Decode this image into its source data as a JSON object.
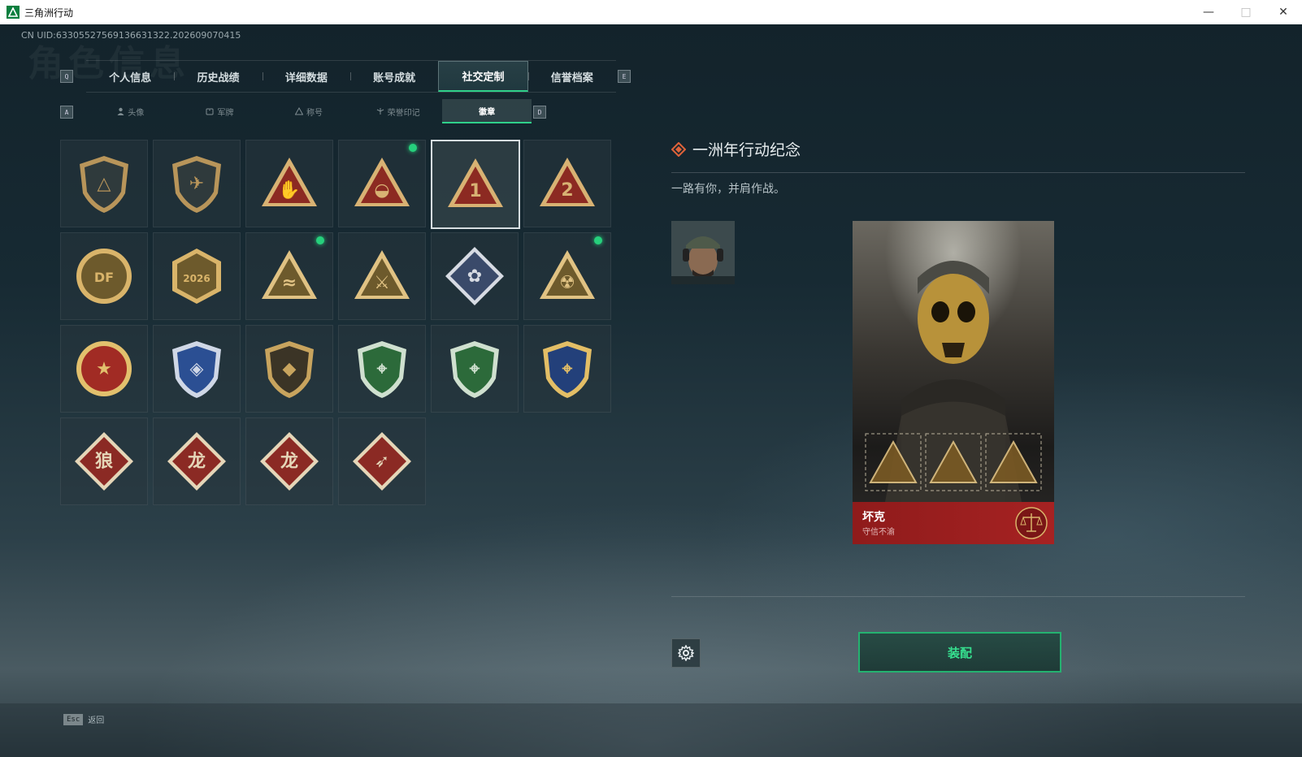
{
  "window": {
    "title": "三角洲行动",
    "controls": {
      "minimize": "—",
      "maximize": "□",
      "close": "✕"
    }
  },
  "uid_text": "CN UID:63305527569136631322.202609070415",
  "background_watermark": "角色信息",
  "key_hints": {
    "prev_tab": "Q",
    "next_tab": "E",
    "prev_subtab": "A",
    "next_subtab": "D"
  },
  "tabs": [
    {
      "label": "个人信息",
      "active": false
    },
    {
      "label": "历史战绩",
      "active": false
    },
    {
      "label": "详细数据",
      "active": false
    },
    {
      "label": "账号成就",
      "active": false
    },
    {
      "label": "社交定制",
      "active": true
    },
    {
      "label": "信誉档案",
      "active": false
    }
  ],
  "subtabs": [
    {
      "label": "头像",
      "icon": "person-icon",
      "active": false
    },
    {
      "label": "军牌",
      "icon": "dogtag-icon",
      "active": false
    },
    {
      "label": "称号",
      "icon": "title-icon",
      "active": false
    },
    {
      "label": "荣誉印记",
      "icon": "honor-icon",
      "active": false
    },
    {
      "label": "徽章",
      "icon": "",
      "active": true
    }
  ],
  "badges": [
    {
      "name": "badge-shield-delta",
      "new": false,
      "selected": false,
      "kind": "shield",
      "primary": "#2f3a3c",
      "accent": "#b8955a",
      "glyph": "△"
    },
    {
      "name": "badge-helicopter",
      "new": false,
      "selected": false,
      "kind": "shield",
      "primary": "#2f3a3c",
      "accent": "#b8955a",
      "glyph": "✈"
    },
    {
      "name": "badge-rock-hand",
      "new": false,
      "selected": false,
      "kind": "triangle",
      "primary": "#8c2a22",
      "accent": "#d8b273",
      "glyph": "✋"
    },
    {
      "name": "badge-nest",
      "new": true,
      "selected": false,
      "kind": "triangle",
      "primary": "#8c2a22",
      "accent": "#d8b273",
      "glyph": "◒"
    },
    {
      "name": "badge-number-one",
      "new": false,
      "selected": true,
      "kind": "triangle",
      "primary": "#8c2a22",
      "accent": "#d8b273",
      "glyph": "1"
    },
    {
      "name": "badge-number-two",
      "new": false,
      "selected": false,
      "kind": "triangle",
      "primary": "#8c2a22",
      "accent": "#d8b273",
      "glyph": "2"
    },
    {
      "name": "badge-delta-force-2025",
      "new": false,
      "selected": false,
      "kind": "round",
      "primary": "#6d5a2c",
      "accent": "#d9b46a",
      "glyph": "DF"
    },
    {
      "name": "badge-delta-force-2026",
      "new": false,
      "selected": false,
      "kind": "hex",
      "primary": "#6d5a2c",
      "accent": "#d9b46a",
      "glyph": "2026"
    },
    {
      "name": "badge-wave-rider",
      "new": true,
      "selected": false,
      "kind": "triangle",
      "primary": "#6d5a2c",
      "accent": "#e0c283",
      "glyph": "≈"
    },
    {
      "name": "badge-soldiers",
      "new": false,
      "selected": false,
      "kind": "triangle",
      "primary": "#6d5a2c",
      "accent": "#e0c283",
      "glyph": "⚔"
    },
    {
      "name": "badge-white-rose",
      "new": false,
      "selected": false,
      "kind": "diamond",
      "primary": "#3a4a6a",
      "accent": "#d7dbe3",
      "glyph": "✿"
    },
    {
      "name": "badge-hazmat",
      "new": true,
      "selected": false,
      "kind": "triangle",
      "primary": "#6d5a2c",
      "accent": "#e0c283",
      "glyph": "☢"
    },
    {
      "name": "badge-star-medal",
      "new": false,
      "selected": false,
      "kind": "round",
      "primary": "#a12b24",
      "accent": "#e2c06d",
      "glyph": "★"
    },
    {
      "name": "badge-blue-wings",
      "new": false,
      "selected": false,
      "kind": "shield",
      "primary": "#2b4f93",
      "accent": "#cfd7e6",
      "glyph": "◈"
    },
    {
      "name": "badge-gem-shield",
      "new": false,
      "selected": false,
      "kind": "shield",
      "primary": "#3b3426",
      "accent": "#c8a45e",
      "glyph": "◆"
    },
    {
      "name": "badge-green-rifle-1",
      "new": false,
      "selected": false,
      "kind": "shield",
      "primary": "#2c6a3a",
      "accent": "#cfe0cf",
      "glyph": "⌖"
    },
    {
      "name": "badge-green-rifle-2",
      "new": false,
      "selected": false,
      "kind": "shield",
      "primary": "#2c6a3a",
      "accent": "#cfe0cf",
      "glyph": "⌖"
    },
    {
      "name": "badge-navy-rifle",
      "new": false,
      "selected": false,
      "kind": "shield",
      "primary": "#23407a",
      "accent": "#e3be66",
      "glyph": "⌖"
    },
    {
      "name": "badge-wolf",
      "new": false,
      "selected": false,
      "kind": "diamond",
      "primary": "#8b2a24",
      "accent": "#e5d6b8",
      "glyph": "狼"
    },
    {
      "name": "badge-dragon-1",
      "new": false,
      "selected": false,
      "kind": "diamond",
      "primary": "#8b2a24",
      "accent": "#e5d6b8",
      "glyph": "龙"
    },
    {
      "name": "badge-dragon-2",
      "new": false,
      "selected": false,
      "kind": "diamond",
      "primary": "#8b2a24",
      "accent": "#e5d6b8",
      "glyph": "龙"
    },
    {
      "name": "badge-runner",
      "new": false,
      "selected": false,
      "kind": "diamond",
      "primary": "#8b2a24",
      "accent": "#e5d6b8",
      "glyph": "➶"
    }
  ],
  "detail": {
    "title": "一洲年行动纪念",
    "description": "一路有你，并肩作战。",
    "preview": {
      "name": "坏克",
      "subtitle": "守信不渝"
    }
  },
  "actions": {
    "equip_label": "装配"
  },
  "footer": {
    "esc_key": "Esc",
    "back_label": "返回"
  },
  "colors": {
    "accent_green": "#2fd08a",
    "new_dot": "#26d07c",
    "preview_red": "#a62222"
  }
}
